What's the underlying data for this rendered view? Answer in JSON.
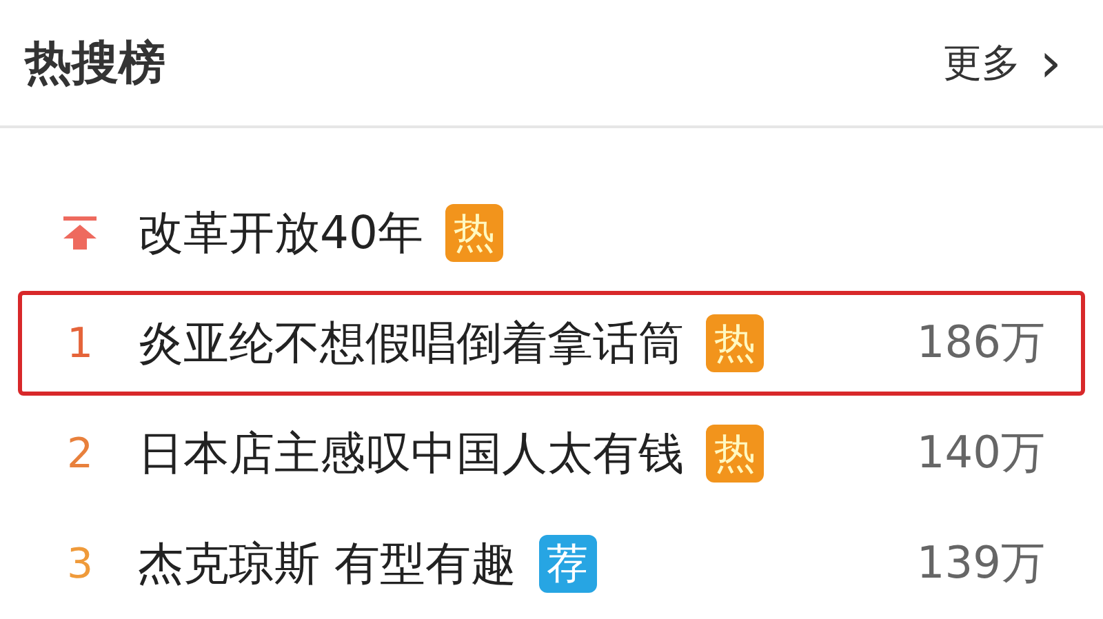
{
  "header": {
    "title": "热搜榜",
    "more_link": "更多",
    "more_arrow": "›"
  },
  "items": [
    {
      "kind": "pinned",
      "title": "改革开放40年",
      "badge": {
        "kind": "hot",
        "label": "热"
      },
      "highlighted": false
    },
    {
      "kind": "ranked",
      "rank": "1",
      "color": "#e5643a",
      "title": "炎亚纶不想假唱倒着拿话筒",
      "badge": {
        "kind": "hot",
        "label": "热"
      },
      "count": "186万",
      "highlighted": true
    },
    {
      "kind": "ranked",
      "rank": "2",
      "color": "#e8803c",
      "title": "日本店主感叹中国人太有钱",
      "badge": {
        "kind": "hot",
        "label": "热"
      },
      "count": "140万",
      "highlighted": false
    },
    {
      "kind": "ranked",
      "rank": "3",
      "color": "#ef9a3a",
      "title": "杰克琼斯 有型有趣",
      "badge": {
        "kind": "recommend",
        "label": "荐"
      },
      "count": "139万",
      "highlighted": false
    }
  ]
}
